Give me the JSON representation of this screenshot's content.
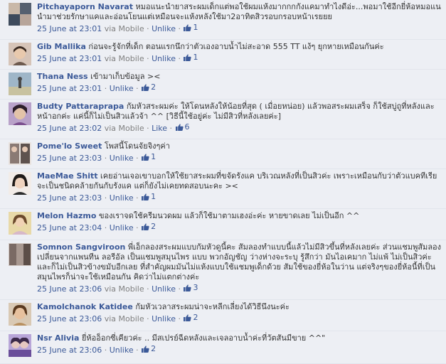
{
  "comments": [
    {
      "author": "Pitchayaporn Navarat",
      "text": "หมอแนะนำยาสระผมเด็กแต่พอใช้ผมแห้งมากกกกังแคมาทำไงดีอ่ะ...พอมาใช้อีกยี่ห้อหมอแน นำมาช่วยรักษาแคและอ่อนโยนแต่เหมือนจะแห้งหลังใช้มา2อาทิตสิวรอบกรอบหน้าเรยยย",
      "time": "25 June at 23:01",
      "via": "via Mobile",
      "action": "Unlike",
      "likes": "1",
      "avatar": "avatar-pitchayaporn"
    },
    {
      "author": "Gib Mallika",
      "text": "ก่อนจะรู้จักที่เด็ก ตอนแรกนึกว่าตัวเองอาบน้ำไม่สะอาด 555 TT แง้ๆ ยุกหายเหมือนกันค่ะ",
      "time": "25 June at 23:01",
      "via": "via Mobile",
      "action": "Unlike",
      "likes": "1",
      "avatar": "avatar-gib"
    },
    {
      "author": "Thana Ness",
      "text": "เข้ามาเก็บข้อมูล ><",
      "time": "25 June at 23:01",
      "via": "",
      "action": "Unlike",
      "likes": "2",
      "avatar": "avatar-thana"
    },
    {
      "author": "Budty Pattaraprapa",
      "text": "กัมหัวสระผมค่ะ ให้โดนหลังให้น้อยที่สุด ( เมื่อยหน่อย) แล้วพอสระผมเสร็จ ก็ใช้สบู่ถูที่หลังและหน้าอกค่ะ แค่นี้ก็ไม่เป็นสิวแล้วจ้า ^^ [วิธีนี้ใช้อยู่ค่ะ ไม่มีสิวที่หลังเลยค่ะ]",
      "time": "25 June at 23:02",
      "via": "via Mobile",
      "action": "Like",
      "likes": "6",
      "avatar": "avatar-budty"
    },
    {
      "author": "Pome'lo Sweet",
      "text": "โพสนี้โดนจัยจิงๆค่า",
      "time": "25 June at 23:03",
      "via": "",
      "action": "Unlike",
      "likes": "1",
      "avatar": "avatar-pomelo"
    },
    {
      "author": "MaeMae Shitt",
      "text": "เคยอ่านเจอเขาบอกให้ใช้ยาสระผมที่ขจัดรังแค บริเวณหลังที่เป็นสิวค่ะ เพราะเหมือนกับว่าตัวแบคทีเรียจะเป็นชนิดคล้ายกันกับรังแค แต่ก็ยังไม่เคยทดสอบนะคะ ><",
      "time": "25 June at 23:03",
      "via": "",
      "action": "Unlike",
      "likes": "1",
      "avatar": "avatar-maemae"
    },
    {
      "author": "Melon Hazmo",
      "text": "ของเราจดใช้ครีมนวดผม แล้วก็ใช้มาตามเฮงอ่ะค่ะ หายขาดเลย ไม่เป็นอีก ^^",
      "time": "25 June at 23:04",
      "via": "",
      "action": "Unlike",
      "likes": "2",
      "avatar": "avatar-melon"
    },
    {
      "author": "Somnon Sangviroon",
      "text": "พี่เอ็กลองสระผมแบบกัมหัวดูนี้คะ สัมลองทำแบบนี้แล้วไม่มีสิวขึ้นที่หลังเลยค่ะ ส่วนแชมพูสัมลองเปลี่ยนจากแพนทีน ลอรีอัล เป็นแชมพูสมุนไพร แบบ พวกอัญชัญ ว่างห่างจะระบุ รู้สึกว่า มันไอเคมาก ไม่แพ้ ไม่เป็นสิวค่ะ และก็ไม่เป็นสิวข้างขมับอีกเลย ที่สำคัญผมมันไม่แห้งแบบใช้แชมพูเด็กด้วย สัมใช้ของยี่ห้อในว่าน แต่จริงๆของยี่ห้อนี้ที่เป็นสมุนไพรก็น่าจะใช้เหมือนกัน คิดว่าไม่แตกต่างค่ะ",
      "time": "25 June at 23:06",
      "via": "via Mobile",
      "action": "Unlike",
      "likes": "3",
      "avatar": "avatar-somnon"
    },
    {
      "author": "Kamolchanok Katidee",
      "text": "กัมหัวเวลาสระผมน่าจะหลีกเลี่ยงได้วิธีนึงนะค่ะ",
      "time": "25 June at 23:06",
      "via": "via Mobile",
      "action": "Unlike",
      "likes": "2",
      "avatar": "avatar-kamolchanok"
    },
    {
      "author": "Nsr Alivia",
      "text": "ยี่ห้ออ็อกซี่เคียวค่ะ .. มีสเปรย์ฉีดหลังและเจลอาบน้ำค่ะที่วัตสันมีขาย ^^\"",
      "time": "25 June at 23:06",
      "via": "",
      "action": "Unlike",
      "likes": "2",
      "avatar": "avatar-nsr"
    }
  ],
  "labels": {
    "separator": "·"
  },
  "colors": {
    "link": "#3b5998",
    "background": "#edeff4",
    "meta": "#808080"
  }
}
